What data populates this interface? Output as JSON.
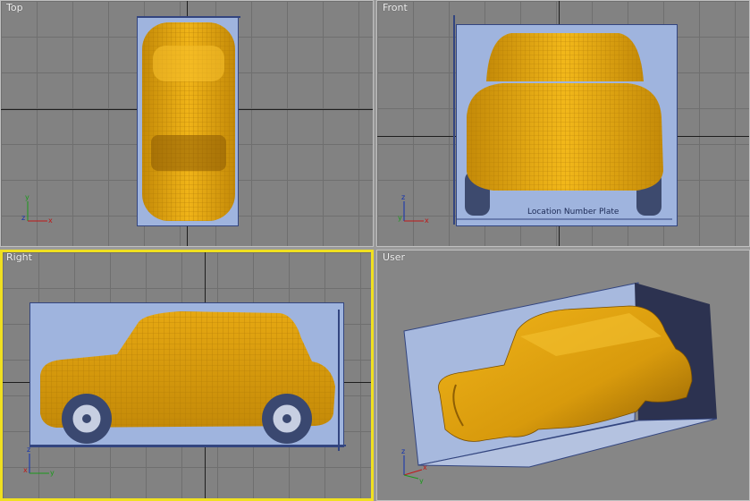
{
  "viewports": {
    "top": {
      "label": "Top"
    },
    "front": {
      "label": "Front",
      "blueprint_text": "Location Number Plate"
    },
    "right": {
      "label": "Right"
    },
    "user": {
      "label": "User"
    }
  },
  "axis_labels": {
    "x": "x",
    "y": "y",
    "z": "z"
  },
  "colors": {
    "active_border": "#f0e020",
    "mesh_fill": "#e8a80c",
    "blueprint": "#9fb4de",
    "grid_bg": "#828282"
  }
}
